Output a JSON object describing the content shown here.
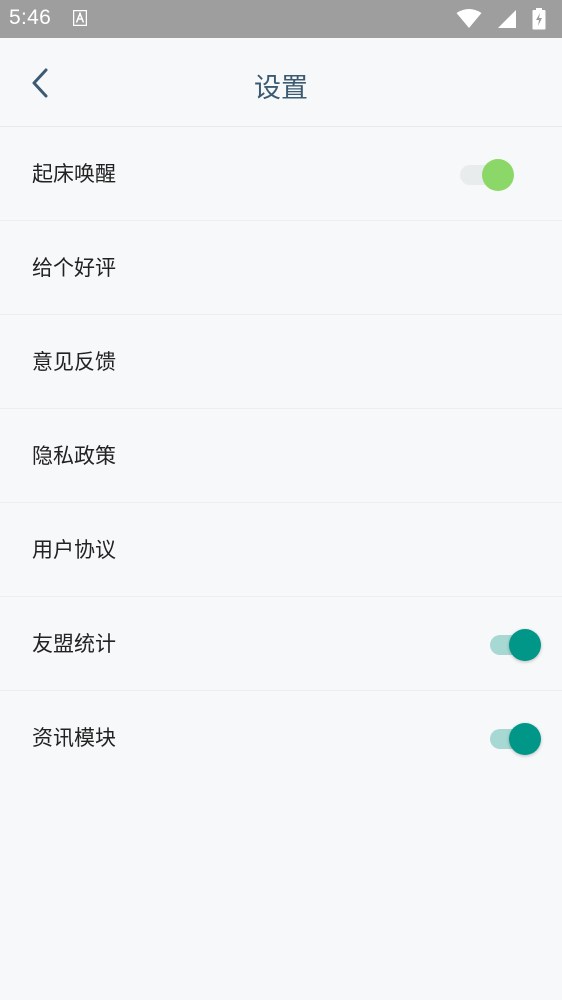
{
  "status_bar": {
    "time": "5:46",
    "icons": [
      "text-a-icon",
      "wifi-icon",
      "signal-icon",
      "battery-charging-icon"
    ]
  },
  "header": {
    "title": "设置",
    "back_icon": "chevron-left-icon"
  },
  "settings": {
    "items": [
      {
        "label": "起床唤醒",
        "has_toggle": true,
        "toggle_on": true,
        "toggle_style": "green"
      },
      {
        "label": "给个好评",
        "has_toggle": false
      },
      {
        "label": "意见反馈",
        "has_toggle": false
      },
      {
        "label": "隐私政策",
        "has_toggle": false
      },
      {
        "label": "用户协议",
        "has_toggle": false
      },
      {
        "label": "友盟统计",
        "has_toggle": true,
        "toggle_on": true,
        "toggle_style": "teal"
      },
      {
        "label": "资讯模块",
        "has_toggle": true,
        "toggle_on": true,
        "toggle_style": "teal"
      }
    ]
  },
  "colors": {
    "status_bar_bg": "#9e9e9e",
    "title_color": "#3d5a73",
    "green_knob": "#8bd868",
    "green_track": "#e9ecec",
    "teal_knob": "#009688",
    "teal_track": "#a8d8d3"
  }
}
